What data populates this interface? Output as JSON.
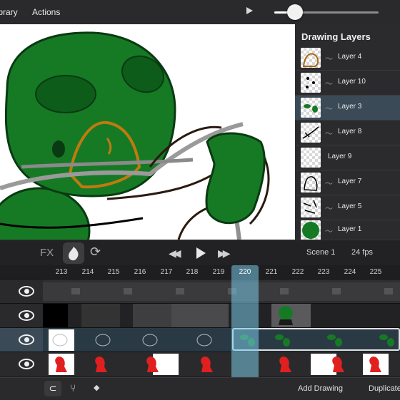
{
  "topbar": {
    "menu_library": "Library",
    "menu_actions": "Actions",
    "play_icon": "play-icon",
    "slider_value": 0.2
  },
  "layers_panel": {
    "title": "Drawing Layers",
    "layers": [
      {
        "name": "Layer 4",
        "thumb": "brown-outline"
      },
      {
        "name": "Layer 10",
        "thumb": "dots"
      },
      {
        "name": "Layer 3",
        "thumb": "green-leaves",
        "selected": true
      },
      {
        "name": "Layer 8",
        "thumb": "black-lines"
      },
      {
        "name": "Layer 9",
        "thumb": "empty"
      },
      {
        "name": "Layer 7",
        "thumb": "black-shape"
      },
      {
        "name": "Layer 5",
        "thumb": "black-strokes"
      },
      {
        "name": "Layer 1",
        "thumb": "green-circle"
      }
    ]
  },
  "controls": {
    "fx_label": "FX",
    "scene_label": "Scene 1",
    "fps_label": "24 fps"
  },
  "timeline": {
    "frames": [
      "213",
      "214",
      "215",
      "216",
      "217",
      "218",
      "219",
      "220",
      "221",
      "222",
      "223",
      "224",
      "225"
    ],
    "current_frame": "220"
  },
  "bottombar": {
    "add_drawing_label": "Add Drawing",
    "duplicate_label": "Duplicate"
  },
  "colors": {
    "accent": "#78c8e6",
    "selected_layer": "#3a4a57",
    "duck_green": "#0f6e1e",
    "beak": "#c07a10"
  }
}
